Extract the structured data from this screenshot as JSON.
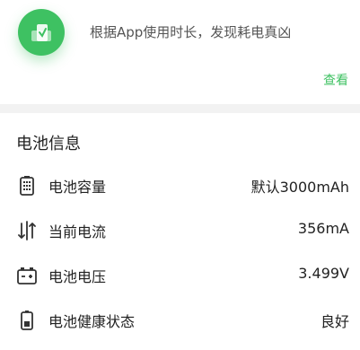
{
  "promo": {
    "icon": "battery-chart-icon",
    "text": "根据App使用时长，发现耗电真凶",
    "link_label": "查看"
  },
  "battery_info": {
    "title": "电池信息",
    "rows": [
      {
        "icon": "battery-capacity-icon",
        "label": "电池容量",
        "value": "默认3000mAh"
      },
      {
        "icon": "current-arrows-icon",
        "label": "当前电流",
        "value": "356mA"
      },
      {
        "icon": "battery-voltage-icon",
        "label": "电池电压",
        "value": "3.499V"
      },
      {
        "icon": "battery-health-icon",
        "label": "电池健康状态",
        "value": "良好"
      }
    ]
  },
  "colors": {
    "accent": "#3ec162",
    "background": "#f2f2f2",
    "card": "#ffffff"
  }
}
